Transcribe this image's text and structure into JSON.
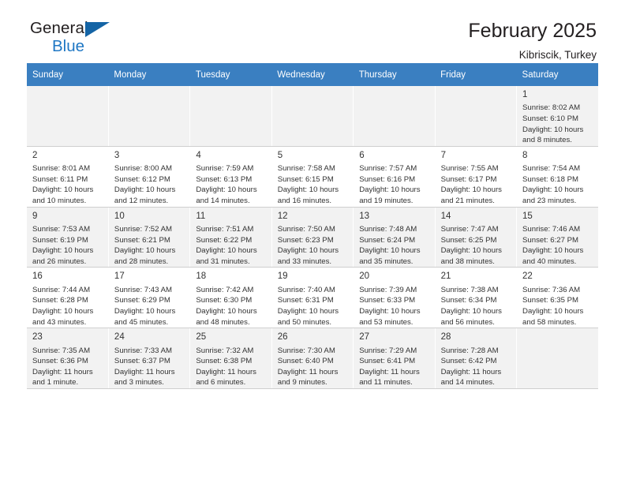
{
  "brand": {
    "name_part1": "General",
    "name_part2": "Blue",
    "logo_icon": "blue-triangle-icon"
  },
  "header": {
    "month_title": "February 2025",
    "location": "Kibriscik, Turkey"
  },
  "calendar": {
    "weekday_headers": [
      "Sunday",
      "Monday",
      "Tuesday",
      "Wednesday",
      "Thursday",
      "Friday",
      "Saturday"
    ],
    "accent_color": "#3a7fc1",
    "alt_row_color": "#f2f2f2",
    "weeks": [
      [
        {
          "day": "",
          "detail": ""
        },
        {
          "day": "",
          "detail": ""
        },
        {
          "day": "",
          "detail": ""
        },
        {
          "day": "",
          "detail": ""
        },
        {
          "day": "",
          "detail": ""
        },
        {
          "day": "",
          "detail": ""
        },
        {
          "day": "1",
          "detail": "Sunrise: 8:02 AM\nSunset: 6:10 PM\nDaylight: 10 hours\nand 8 minutes."
        }
      ],
      [
        {
          "day": "2",
          "detail": "Sunrise: 8:01 AM\nSunset: 6:11 PM\nDaylight: 10 hours\nand 10 minutes."
        },
        {
          "day": "3",
          "detail": "Sunrise: 8:00 AM\nSunset: 6:12 PM\nDaylight: 10 hours\nand 12 minutes."
        },
        {
          "day": "4",
          "detail": "Sunrise: 7:59 AM\nSunset: 6:13 PM\nDaylight: 10 hours\nand 14 minutes."
        },
        {
          "day": "5",
          "detail": "Sunrise: 7:58 AM\nSunset: 6:15 PM\nDaylight: 10 hours\nand 16 minutes."
        },
        {
          "day": "6",
          "detail": "Sunrise: 7:57 AM\nSunset: 6:16 PM\nDaylight: 10 hours\nand 19 minutes."
        },
        {
          "day": "7",
          "detail": "Sunrise: 7:55 AM\nSunset: 6:17 PM\nDaylight: 10 hours\nand 21 minutes."
        },
        {
          "day": "8",
          "detail": "Sunrise: 7:54 AM\nSunset: 6:18 PM\nDaylight: 10 hours\nand 23 minutes."
        }
      ],
      [
        {
          "day": "9",
          "detail": "Sunrise: 7:53 AM\nSunset: 6:19 PM\nDaylight: 10 hours\nand 26 minutes."
        },
        {
          "day": "10",
          "detail": "Sunrise: 7:52 AM\nSunset: 6:21 PM\nDaylight: 10 hours\nand 28 minutes."
        },
        {
          "day": "11",
          "detail": "Sunrise: 7:51 AM\nSunset: 6:22 PM\nDaylight: 10 hours\nand 31 minutes."
        },
        {
          "day": "12",
          "detail": "Sunrise: 7:50 AM\nSunset: 6:23 PM\nDaylight: 10 hours\nand 33 minutes."
        },
        {
          "day": "13",
          "detail": "Sunrise: 7:48 AM\nSunset: 6:24 PM\nDaylight: 10 hours\nand 35 minutes."
        },
        {
          "day": "14",
          "detail": "Sunrise: 7:47 AM\nSunset: 6:25 PM\nDaylight: 10 hours\nand 38 minutes."
        },
        {
          "day": "15",
          "detail": "Sunrise: 7:46 AM\nSunset: 6:27 PM\nDaylight: 10 hours\nand 40 minutes."
        }
      ],
      [
        {
          "day": "16",
          "detail": "Sunrise: 7:44 AM\nSunset: 6:28 PM\nDaylight: 10 hours\nand 43 minutes."
        },
        {
          "day": "17",
          "detail": "Sunrise: 7:43 AM\nSunset: 6:29 PM\nDaylight: 10 hours\nand 45 minutes."
        },
        {
          "day": "18",
          "detail": "Sunrise: 7:42 AM\nSunset: 6:30 PM\nDaylight: 10 hours\nand 48 minutes."
        },
        {
          "day": "19",
          "detail": "Sunrise: 7:40 AM\nSunset: 6:31 PM\nDaylight: 10 hours\nand 50 minutes."
        },
        {
          "day": "20",
          "detail": "Sunrise: 7:39 AM\nSunset: 6:33 PM\nDaylight: 10 hours\nand 53 minutes."
        },
        {
          "day": "21",
          "detail": "Sunrise: 7:38 AM\nSunset: 6:34 PM\nDaylight: 10 hours\nand 56 minutes."
        },
        {
          "day": "22",
          "detail": "Sunrise: 7:36 AM\nSunset: 6:35 PM\nDaylight: 10 hours\nand 58 minutes."
        }
      ],
      [
        {
          "day": "23",
          "detail": "Sunrise: 7:35 AM\nSunset: 6:36 PM\nDaylight: 11 hours\nand 1 minute."
        },
        {
          "day": "24",
          "detail": "Sunrise: 7:33 AM\nSunset: 6:37 PM\nDaylight: 11 hours\nand 3 minutes."
        },
        {
          "day": "25",
          "detail": "Sunrise: 7:32 AM\nSunset: 6:38 PM\nDaylight: 11 hours\nand 6 minutes."
        },
        {
          "day": "26",
          "detail": "Sunrise: 7:30 AM\nSunset: 6:40 PM\nDaylight: 11 hours\nand 9 minutes."
        },
        {
          "day": "27",
          "detail": "Sunrise: 7:29 AM\nSunset: 6:41 PM\nDaylight: 11 hours\nand 11 minutes."
        },
        {
          "day": "28",
          "detail": "Sunrise: 7:28 AM\nSunset: 6:42 PM\nDaylight: 11 hours\nand 14 minutes."
        },
        {
          "day": "",
          "detail": ""
        }
      ]
    ]
  }
}
